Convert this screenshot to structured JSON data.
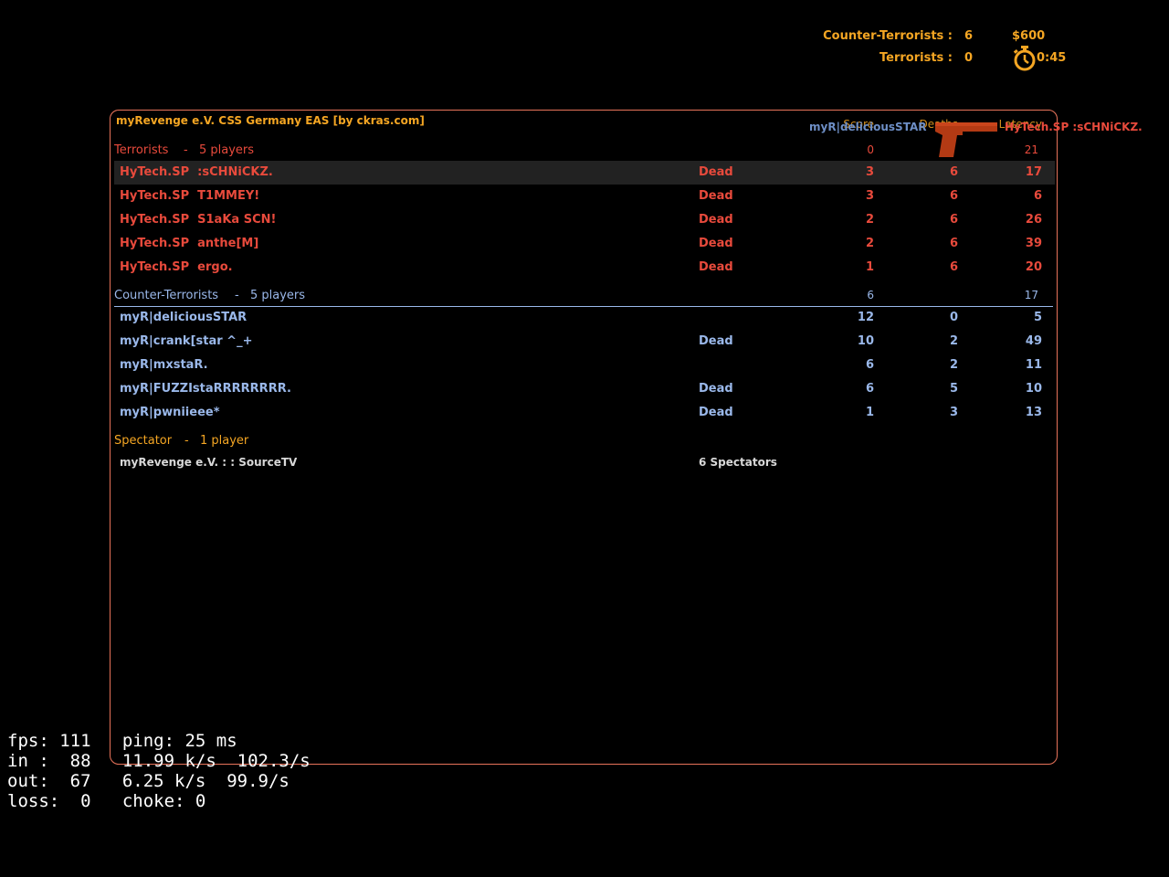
{
  "hud": {
    "ct_label": "Counter-Terrorists :",
    "ct_count": "6",
    "t_label": "Terrorists :",
    "t_count": "0",
    "money": "$600",
    "timer": "0:45"
  },
  "killfeed": {
    "attacker": "myR|deliciousSTAR",
    "weapon_icon": "pistol-icon",
    "victim": "HyTech.SP  :sCHNiCKZ."
  },
  "scoreboard": {
    "server_name": "myRevenge e.V. CSS Germany EAS [by ckras.com]",
    "columns": {
      "score": "Score",
      "deaths": "Deaths",
      "latency": "Latency"
    },
    "terrorists": {
      "name": "Terrorists",
      "sep": "-",
      "count_label": "5 players",
      "score": "0",
      "latency": "21",
      "players": [
        {
          "name": "HyTech.SP  :sCHNiCKZ.",
          "status": "Dead",
          "score": "3",
          "deaths": "6",
          "latency": "17"
        },
        {
          "name": "HyTech.SP  T1MMEY!",
          "status": "Dead",
          "score": "3",
          "deaths": "6",
          "latency": "6"
        },
        {
          "name": "HyTech.SP  S1aKa SCN!",
          "status": "Dead",
          "score": "2",
          "deaths": "6",
          "latency": "26"
        },
        {
          "name": "HyTech.SP  anthe[M]",
          "status": "Dead",
          "score": "2",
          "deaths": "6",
          "latency": "39"
        },
        {
          "name": "HyTech.SP  ergo.",
          "status": "Dead",
          "score": "1",
          "deaths": "6",
          "latency": "20"
        }
      ]
    },
    "counter_terrorists": {
      "name": "Counter-Terrorists",
      "sep": "-",
      "count_label": "5 players",
      "score": "6",
      "latency": "17",
      "players": [
        {
          "name": "myR|deliciousSTAR",
          "status": "",
          "score": "12",
          "deaths": "0",
          "latency": "5"
        },
        {
          "name": "myR|crank[star ^_+",
          "status": "Dead",
          "score": "10",
          "deaths": "2",
          "latency": "49"
        },
        {
          "name": "myR|mxstaR.",
          "status": "",
          "score": "6",
          "deaths": "2",
          "latency": "11"
        },
        {
          "name": "myR|FUZZIstaRRRRRRRR.",
          "status": "Dead",
          "score": "6",
          "deaths": "5",
          "latency": "10"
        },
        {
          "name": "myR|pwniieee*",
          "status": "Dead",
          "score": "1",
          "deaths": "3",
          "latency": "13"
        }
      ]
    },
    "spectators": {
      "name": "Spectator",
      "sep": "-",
      "count_label": "1 player",
      "players": [
        {
          "name": "myRevenge e.V. : : SourceTV",
          "status": "6 Spectators"
        }
      ]
    }
  },
  "netgraph": {
    "line1": "fps: 111   ping: 25 ms",
    "line2": "in :  88   11.99 k/s  102.3/s",
    "line3": "out:  67   6.25 k/s  99.9/s",
    "line4": "loss:  0   choke: 0"
  },
  "colors": {
    "accent": "#f5a623",
    "terrorist": "#e84a3c",
    "counter_terrorist": "#9ab8ea",
    "border": "#e8735a"
  }
}
